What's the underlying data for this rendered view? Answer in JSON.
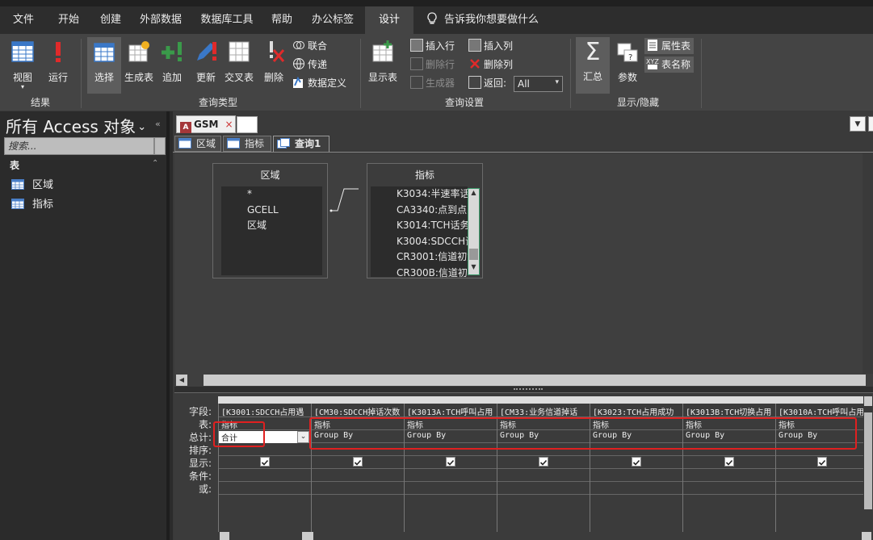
{
  "menu": {
    "tabs": [
      "文件",
      "开始",
      "创建",
      "外部数据",
      "数据库工具",
      "帮助",
      "办公标签",
      "设计"
    ],
    "tellme": "告诉我你想要做什么"
  },
  "ribbon": {
    "results": {
      "view": "视图",
      "run": "运行",
      "group": "结果"
    },
    "querytype": {
      "select": "选择",
      "maketable": "生成表",
      "append": "追加",
      "update": "更新",
      "crosstab": "交叉表",
      "delete": "删除",
      "union": "联合",
      "passthrough": "传递",
      "datadef": "数据定义",
      "group": "查询类型"
    },
    "setup": {
      "showtable": "显示表",
      "insertrow": "插入行",
      "deleterow": "删除行",
      "builder": "生成器",
      "insertcol": "插入列",
      "deletecol": "删除列",
      "return_label": "返回:",
      "return_value": "All",
      "group": "查询设置"
    },
    "showhide": {
      "totals": "汇总",
      "params": "参数",
      "propsheet": "属性表",
      "tablenames": "表名称",
      "group": "显示/隐藏"
    }
  },
  "nav": {
    "title": "所有 Access 对象",
    "search_placeholder": "搜索...",
    "section": "表",
    "items": [
      "区域",
      "指标"
    ]
  },
  "doc": {
    "file_tab": "GSM",
    "tabs": [
      "区域",
      "指标",
      "查询1"
    ]
  },
  "design": {
    "table1": {
      "name": "区域",
      "fields": [
        "*",
        "GCELL",
        "区域"
      ]
    },
    "table2": {
      "name": "指标",
      "fields": [
        "K3034:半速率话",
        "CA3340:点到点",
        "K3014:TCH话务",
        "K3004:SDCCH话",
        "CR3001:信道初始",
        "CR300B:信道初始"
      ]
    }
  },
  "grid": {
    "row_labels": [
      "字段:",
      "表:",
      "总计:",
      "排序:",
      "显示:",
      "条件:",
      "或:"
    ],
    "columns": [
      {
        "field": "[K3001:SDCCH占用遇",
        "table": "指标",
        "total": "合计"
      },
      {
        "field": "[CM30:SDCCH掉话次数",
        "table": "指标",
        "total": "Group By"
      },
      {
        "field": "[K3013A:TCH呼叫占用",
        "table": "指标",
        "total": "Group By"
      },
      {
        "field": "[CM33:业务信道掉话",
        "table": "指标",
        "total": "Group By"
      },
      {
        "field": "[K3023:TCH占用成功",
        "table": "指标",
        "total": "Group By"
      },
      {
        "field": "[K3013B:TCH切换占用",
        "table": "指标",
        "total": "Group By"
      },
      {
        "field": "[K3010A:TCH呼叫占用",
        "table": "指标",
        "total": "Group By"
      }
    ]
  }
}
